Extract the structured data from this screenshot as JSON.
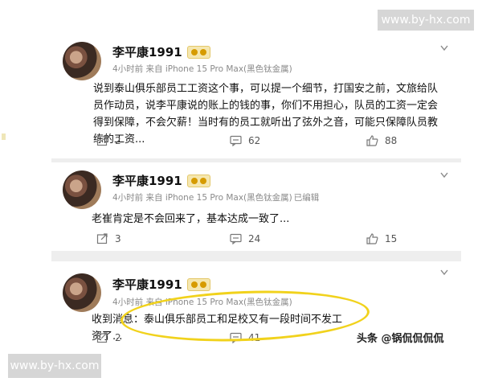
{
  "watermark": {
    "top": "www.by-hx.com",
    "bottom": "www.by-hx.com"
  },
  "source_tag": "头条 @锅侃侃侃侃",
  "accent": {
    "highlight": "#f1d21c",
    "badge": "#f5e7b0"
  },
  "posts": [
    {
      "user": "李平康1991",
      "meta": "4小时前 来自 iPhone 15 Pro Max(黑色钛金属)",
      "edited": "",
      "content": "说到泰山俱乐部员工工资这个事，可以提一个细节，打国安之前，文旅给队员作动员，说李平康说的账上的钱的事，你们不用担心，队员的工资一定会得到保障，不会欠薪！当时有的员工就听出了弦外之音，可能只保障队员教练的工资...",
      "reposts": "2",
      "comments": "62",
      "likes": "88"
    },
    {
      "user": "李平康1991",
      "meta": "4小时前 来自 iPhone 15 Pro Max(黑色钛金属)",
      "edited": "已编辑",
      "content": "老崔肯定是不会回来了，基本达成一致了...",
      "reposts": "3",
      "comments": "24",
      "likes": "15"
    },
    {
      "user": "李平康1991",
      "meta": "4小时前 来自 iPhone 15 Pro Max(黑色钛金属)",
      "edited": "",
      "content": "收到消息：泰山俱乐部员工和足校又有一段时间不发工资了...",
      "reposts": "2",
      "comments": "41",
      "likes": ""
    }
  ],
  "icons": {
    "repost": "repost-icon",
    "comment": "comment-icon",
    "like": "like-icon",
    "more": "chevron-down-icon"
  }
}
